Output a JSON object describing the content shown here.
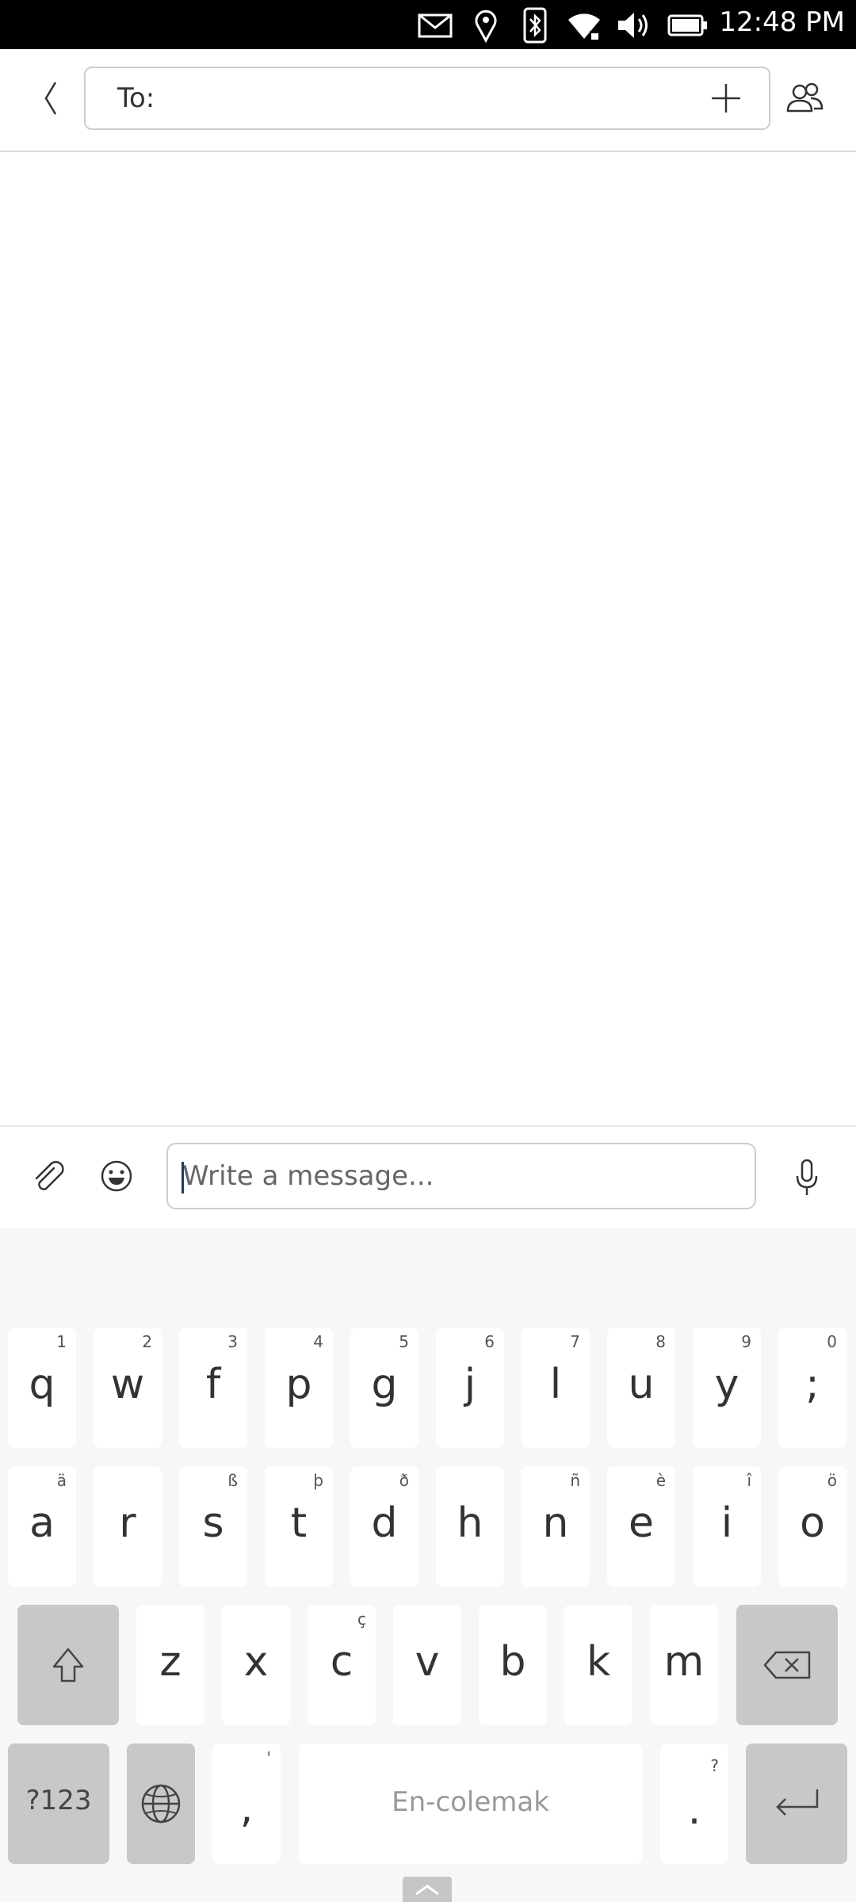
{
  "status_bar": {
    "time": "12:48 PM",
    "icons": [
      "mail-icon",
      "location-icon",
      "bluetooth-icon",
      "wifi-icon",
      "volume-icon",
      "battery-icon"
    ]
  },
  "header": {
    "to_label": "To:",
    "icons": {
      "back": "chevron-left-icon",
      "add": "plus-icon",
      "contacts": "contacts-icon"
    }
  },
  "compose": {
    "placeholder": "Write a message...",
    "value": "",
    "icons": {
      "attach": "paperclip-icon",
      "emoji": "emoji-icon",
      "mic": "microphone-icon"
    }
  },
  "keyboard": {
    "row1": [
      {
        "key": "q",
        "sub": "1"
      },
      {
        "key": "w",
        "sub": "2"
      },
      {
        "key": "f",
        "sub": "3"
      },
      {
        "key": "p",
        "sub": "4"
      },
      {
        "key": "g",
        "sub": "5"
      },
      {
        "key": "j",
        "sub": "6"
      },
      {
        "key": "l",
        "sub": "7"
      },
      {
        "key": "u",
        "sub": "8"
      },
      {
        "key": "y",
        "sub": "9"
      },
      {
        "key": ";",
        "sub": "0"
      }
    ],
    "row2": [
      {
        "key": "a",
        "sub": "ä"
      },
      {
        "key": "r",
        "sub": ""
      },
      {
        "key": "s",
        "sub": "ß"
      },
      {
        "key": "t",
        "sub": "þ"
      },
      {
        "key": "d",
        "sub": "ð"
      },
      {
        "key": "h",
        "sub": ""
      },
      {
        "key": "n",
        "sub": "ñ"
      },
      {
        "key": "e",
        "sub": "è"
      },
      {
        "key": "i",
        "sub": "î"
      },
      {
        "key": "o",
        "sub": "ö"
      }
    ],
    "row3": [
      {
        "key": "z",
        "sub": ""
      },
      {
        "key": "x",
        "sub": ""
      },
      {
        "key": "c",
        "sub": "ç"
      },
      {
        "key": "v",
        "sub": ""
      },
      {
        "key": "b",
        "sub": ""
      },
      {
        "key": "k",
        "sub": ""
      },
      {
        "key": "m",
        "sub": ""
      }
    ],
    "symbols_label": "?123",
    "comma": {
      "key": ",",
      "sub": "'"
    },
    "space_label": "En-colemak",
    "period": {
      "key": ".",
      "sub": "?"
    },
    "icons": {
      "shift": "shift-icon",
      "backspace": "backspace-icon",
      "language": "globe-icon",
      "enter": "enter-icon",
      "collapse": "chevron-up-icon"
    }
  }
}
